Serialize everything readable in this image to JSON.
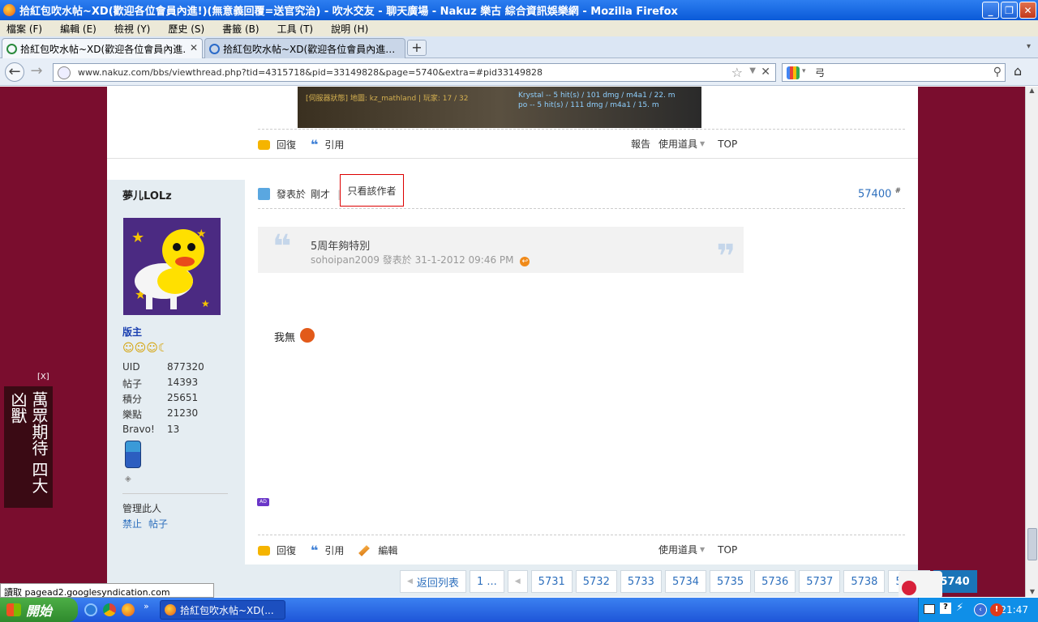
{
  "window": {
    "title": "拾紅包吹水帖~XD(歡迎各位會員內進!)(無意義回覆=送官究治) - 吹水交友 - 聊天廣場 - Nakuz 樂古 綜合資訊娛樂網 - Mozilla Firefox"
  },
  "menu": [
    "檔案 (F)",
    "編輯 (E)",
    "檢視 (Y)",
    "歷史 (S)",
    "書籤 (B)",
    "工具 (T)",
    "說明 (H)"
  ],
  "tabs": [
    {
      "label": "拾紅包吹水帖~XD(歡迎各位會員內進…",
      "close": "✕"
    },
    {
      "label": "拾紅包吹水帖~XD(歡迎各位會員內進…"
    }
  ],
  "nav": {
    "url": "www.nakuz.com/bbs/viewthread.php?tid=4315718&pid=33149828&page=5740&extra=#pid33149828",
    "search_value": "弓"
  },
  "prev_post": {
    "game_lines": [
      "Krystal -- 5 hit(s) / 101 dmg / m4a1 / 22. m",
      "po -- 5 hit(s) / 111 dmg / m4a1 / 15. m"
    ],
    "game_caption": "[伺服器狀態] 地圖: kz_mathland | 玩家: 17 / 32",
    "actions": {
      "reply": "回復",
      "quote": "引用",
      "report": "報告",
      "tools": "使用道具",
      "top": "TOP"
    }
  },
  "post": {
    "author": "夢儿LOLz",
    "posted_prefix": "發表於",
    "posted_time": "剛才",
    "only_author": "只看該作者",
    "floor": "57400",
    "floor_mark": "#",
    "quote_text": "5周年夠特別",
    "quote_meta": "sohoipan2009 發表於 31-1-2012 09:46 PM",
    "body": "我無",
    "role": "版主",
    "stats": [
      {
        "k": "UID",
        "v": "877320"
      },
      {
        "k": "帖子",
        "v": "14393"
      },
      {
        "k": "積分",
        "v": "25651"
      },
      {
        "k": "樂點",
        "v": "21230"
      },
      {
        "k": "Bravo!",
        "v": "13"
      }
    ],
    "manage_title": "管理此人",
    "manage_links": [
      "禁止",
      "帖子"
    ],
    "ad_tag": "AD",
    "actions": {
      "reply": "回復",
      "quote": "引用",
      "edit": "編輯",
      "tools": "使用道具",
      "top": "TOP"
    }
  },
  "pagination": {
    "back": "返回列表",
    "first": "1 ...",
    "pages": [
      "5731",
      "5732",
      "5733",
      "5734",
      "5735",
      "5736",
      "5737",
      "5738",
      "5739"
    ],
    "current": "5740"
  },
  "ad_banner": {
    "close": "[X]",
    "text": "萬眾期待 四大凶獸"
  },
  "status": "讀取 pagead2.googlesyndication.com",
  "taskbar": {
    "start": "開始",
    "task": "拾紅包吹水帖~XD(...",
    "clock": "21:47"
  },
  "colors": {
    "page_bg": "#7a0d2e",
    "link": "#2d6fbd",
    "pager_current": "#1a74b8",
    "highlight_box": "#d00000"
  }
}
